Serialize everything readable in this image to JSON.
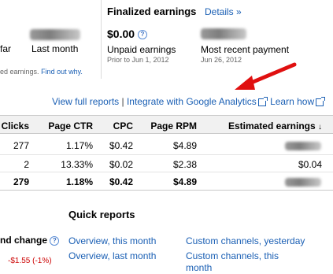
{
  "top": {
    "left_label_far": "far",
    "left_label_last_month": "Last month",
    "left_note_text": "ed earnings.",
    "left_note_link": "Find out why.",
    "finalized_title": "Finalized earnings",
    "details_link": "Details »",
    "unpaid_value": "$0.00",
    "unpaid_label": "Unpaid earnings",
    "unpaid_sub": "Prior to Jun 1, 2012",
    "recent_label": "Most recent payment",
    "recent_sub": "Jun 26, 2012"
  },
  "links_bar": {
    "view_full_reports": "View full reports",
    "sep": "|",
    "integrate_ga": "Integrate with Google Analytics",
    "learn_how": "Learn how"
  },
  "table": {
    "headers": {
      "clicks": "Clicks",
      "page_ctr": "Page CTR",
      "cpc": "CPC",
      "page_rpm": "Page RPM",
      "est_earnings": "Estimated earnings",
      "sort_glyph": "↓"
    },
    "rows": [
      {
        "clicks": "277",
        "page_ctr": "1.17%",
        "cpc": "$0.42",
        "page_rpm": "$4.89",
        "est": ""
      },
      {
        "clicks": "2",
        "page_ctr": "13.33%",
        "cpc": "$0.02",
        "page_rpm": "$2.38",
        "est": "$0.04"
      }
    ],
    "total": {
      "clicks": "279",
      "page_ctr": "1.18%",
      "cpc": "$0.42",
      "page_rpm": "$4.89",
      "est": ""
    }
  },
  "quick_reports": {
    "title": "Quick reports",
    "overview_this_month": "Overview, this month",
    "overview_last_month": "Overview, last month",
    "custom_yesterday": "Custom channels, yesterday",
    "custom_this_month_line1": "Custom channels, this",
    "custom_this_month_line2": "month"
  },
  "left_bottom": {
    "change_label": "nd change",
    "change_value": "-$1.55 (-1%)"
  },
  "colors": {
    "link": "#1a5fb4",
    "negative": "#cc0000",
    "arrow": "#e01010"
  }
}
